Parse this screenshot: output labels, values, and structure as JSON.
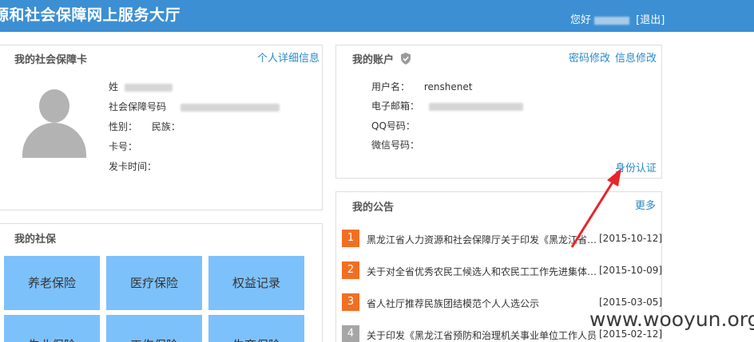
{
  "header": {
    "title": "源和社会保障网上服务大厅",
    "greeting": "您好",
    "logout": "[退出]"
  },
  "social_card": {
    "title": "我的社会保障卡",
    "detail_link": "个人详细信息",
    "fields": {
      "name_label": "姓",
      "card_no_label": "社会保障号码",
      "gender_label": "性别：",
      "ethnicity_label": "民族：",
      "card_label": "卡号：",
      "issue_date_label": "发卡时间："
    }
  },
  "account": {
    "title": "我的账户",
    "password_link": "密码修改",
    "info_link": "信息修改",
    "username_label": "用户名：",
    "username_value": "renshenet",
    "email_label": "电子邮箱：",
    "qq_label": "QQ号码：",
    "wechat_label": "微信号码：",
    "verify_link": "身份认证"
  },
  "social_insurance": {
    "title": "我的社保",
    "tiles": [
      "养老保险",
      "医疗保险",
      "权益记录",
      "失业保险",
      "工伤保险",
      "生育保险"
    ]
  },
  "notices": {
    "title": "我的公告",
    "more_link": "更多",
    "items": [
      {
        "num": "1",
        "text": "黑龙江省人力资源和社会保障厅关于印发《黑龙江省人力资源和社会保障",
        "date": "[2015-10-12]",
        "color": "#f26f22"
      },
      {
        "num": "2",
        "text": "关于对全省优秀农民工候选人和农民工工作先进集体候选单位的公示",
        "date": "[2015-10-09]",
        "color": "#f26f22"
      },
      {
        "num": "3",
        "text": "省人社厅推荐民族团结模范个人人选公示",
        "date": "[2015-03-05]",
        "color": "#f26f22"
      },
      {
        "num": "4",
        "text": "关于印发《黑龙江省预防和治理机关事业单位工作人员",
        "date": "[2015-02-12]",
        "color": "#a6a6a6"
      }
    ]
  },
  "watermark": "www.wooyun.org",
  "colors": {
    "header_bg": "#3c8fd3",
    "tile_bg": "#7dc1fb",
    "link": "#2a8ac9",
    "arrow": "#e8252a"
  }
}
